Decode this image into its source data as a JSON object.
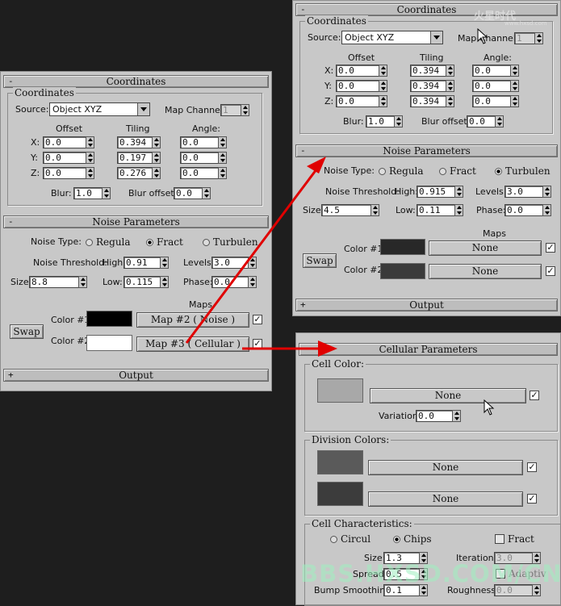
{
  "left": {
    "coordinates": {
      "title": "Coordinates",
      "group": "Coordinates",
      "source_label": "Source:",
      "source_value": "Object XYZ",
      "map_channel_label": "Map Channel:",
      "map_channel_value": "1",
      "offset_label": "Offset",
      "tiling_label": "Tiling",
      "angle_label": "Angle:",
      "x_label": "X:",
      "y_label": "Y:",
      "z_label": "Z:",
      "offset": [
        "0.0",
        "0.0",
        "0.0"
      ],
      "tiling": [
        "0.394",
        "0.197",
        "0.276"
      ],
      "angle": [
        "0.0",
        "0.0",
        "0.0"
      ],
      "blur_label": "Blur:",
      "blur": "1.0",
      "blur_offset_label": "Blur offset:",
      "blur_offset": "0.0"
    },
    "noise": {
      "title": "Noise Parameters",
      "type_label": "Noise Type:",
      "regular": "Regula",
      "fractal": "Fract",
      "turbulence": "Turbulen",
      "threshold_label": "Noise Threshold:",
      "high_label": "High:",
      "high": "0.91",
      "levels_label": "Levels:",
      "levels": "3.0",
      "size_label": "Size:",
      "size": "8.8",
      "low_label": "Low:",
      "low": "0.115",
      "phase_label": "Phase:",
      "phase": "0.0",
      "maps_label": "Maps",
      "color1_label": "Color #1",
      "color2_label": "Color #2",
      "map1": "Map #2  ( Noise )",
      "map2": "Map #3  ( Cellular )",
      "swap": "Swap",
      "color1": "#000000",
      "color2": "#ffffff"
    },
    "output": {
      "title": "Output"
    }
  },
  "right_top": {
    "coordinates": {
      "title": "Coordinates",
      "group": "Coordinates",
      "source_label": "Source:",
      "source_value": "Object XYZ",
      "map_channel_label": "Map Channel:",
      "map_channel_value": "1",
      "offset_label": "Offset",
      "tiling_label": "Tiling",
      "angle_label": "Angle:",
      "x_label": "X:",
      "y_label": "Y:",
      "z_label": "Z:",
      "offset": [
        "0.0",
        "0.0",
        "0.0"
      ],
      "tiling": [
        "0.394",
        "0.394",
        "0.394"
      ],
      "angle": [
        "0.0",
        "0.0",
        "0.0"
      ],
      "blur_label": "Blur:",
      "blur": "1.0",
      "blur_offset_label": "Blur offset:",
      "blur_offset": "0.0"
    },
    "noise": {
      "title": "Noise Parameters",
      "type_label": "Noise Type:",
      "regular": "Regula",
      "fractal": "Fract",
      "turbulence": "Turbulen",
      "threshold_label": "Noise Threshold:",
      "high_label": "High:",
      "high": "0.915",
      "levels_label": "Levels:",
      "levels": "3.0",
      "size_label": "Size:",
      "size": "4.5",
      "low_label": "Low:",
      "low": "0.11",
      "phase_label": "Phase:",
      "phase": "0.0",
      "maps_label": "Maps",
      "color1_label": "Color #1",
      "color2_label": "Color #2",
      "map1": "None",
      "map2": "None",
      "swap": "Swap",
      "color1": "#282828",
      "color2": "#3a3a3a"
    },
    "output": {
      "title": "Output"
    }
  },
  "cellular": {
    "title": "Cellular Parameters",
    "cell_color_group": "Cell Color:",
    "cell_color_map": "None",
    "variation_label": "Variation:",
    "variation": "0.0",
    "division_group": "Division Colors:",
    "division_map1": "None",
    "division_map2": "None",
    "characteristics_group": "Cell Characteristics:",
    "circular": "Circul",
    "chips": "Chips",
    "fractal": "Fract",
    "size_label": "Size:",
    "size": "1.3",
    "spread_label": "Spread:",
    "spread": "0.5",
    "bump_label": "Bump Smoothing:",
    "bump": "0.1",
    "iterations_label": "Iterations:",
    "iterations": "3.0",
    "adaptive_label": "Adaptiv",
    "roughness_label": "Roughness:",
    "roughness": "0.0",
    "cell_color": "#a8a8a8",
    "div_color1": "#5a5a5a",
    "div_color2": "#3c3c3c"
  },
  "watermark": {
    "logo": "火星时代",
    "url": "www.hxsd.com",
    "bottom": "BBS.HXSD.COM/CN"
  },
  "colors": {
    "arrow": "#e00000",
    "panel": "#c8c8c8",
    "background": "#1e1e1e"
  }
}
